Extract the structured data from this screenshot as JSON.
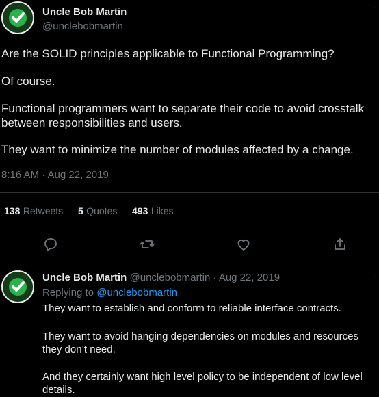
{
  "main_tweet": {
    "author_name": "Uncle Bob Martin",
    "author_handle": "@unclebobmartin",
    "lines": [
      "Are the SOLID principles applicable to Functional Programming?",
      "Of course.",
      "Functional programmers want to separate their code to avoid crosstalk",
      "between responsibilities and users.",
      "They want to minimize the number of modules affected by a change."
    ],
    "timestamp": "8:16 AM · Aug 22, 2019",
    "stats": {
      "retweets_count": "138",
      "retweets_label": "Retweets",
      "quotes_count": "5",
      "quotes_label": "Quotes",
      "likes_count": "493",
      "likes_label": "Likes"
    },
    "actions": [
      "reply-icon",
      "retweet-icon",
      "like-icon",
      "share-icon"
    ]
  },
  "reply_tweet": {
    "author_name": "Uncle Bob Martin",
    "author_handle": "@unclebobmartin",
    "separator": "·",
    "date": "Aug 22, 2019",
    "replying_prefix": "Replying to",
    "replying_handle": "@unclebobmartin",
    "lines": [
      "They want to establish and conform to reliable interface contracts.",
      "They want to avoid hanging dependencies on modules and resources",
      "they don’t need.",
      "And they certainly want high level policy to be independent of low level",
      "details."
    ]
  },
  "colors": {
    "background": "#000000",
    "text": "#e7e9ea",
    "muted": "#71767b",
    "link": "#1d9bf0",
    "avatar_check": "#2bb24c"
  }
}
